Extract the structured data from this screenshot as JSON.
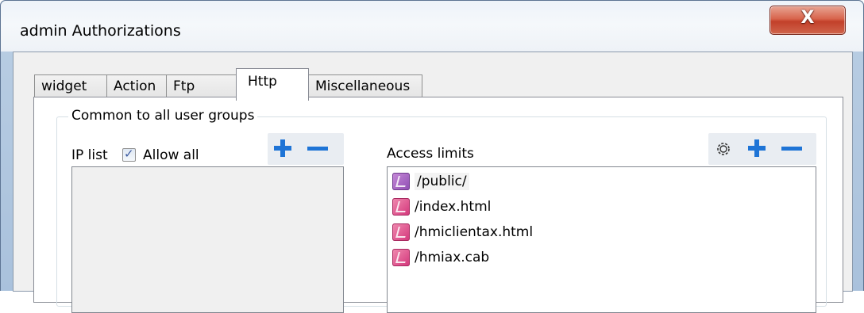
{
  "window": {
    "title": "admin Authorizations",
    "close_label": "X"
  },
  "tabs": [
    {
      "label": "widget",
      "active": false
    },
    {
      "label": "Action",
      "active": false
    },
    {
      "label": "Ftp",
      "active": false
    },
    {
      "label": "Http",
      "active": true
    },
    {
      "label": "Miscellaneous",
      "active": false
    }
  ],
  "group": {
    "legend": "Common to all user groups"
  },
  "ip_list": {
    "label": "IP list",
    "allow_all_label": "Allow all",
    "allow_all_checked": true,
    "items": []
  },
  "access_limits": {
    "label": "Access limits",
    "items": [
      {
        "path": "/public/",
        "selected": true
      },
      {
        "path": "/index.html",
        "selected": false
      },
      {
        "path": "/hmiclientax.html",
        "selected": false
      },
      {
        "path": "/hmiax.cab",
        "selected": false
      }
    ]
  },
  "icons": {
    "add": "plus-icon",
    "remove": "minus-icon",
    "settings": "gear-icon",
    "item": "page-icon"
  },
  "colors": {
    "accent": "#1e74d6",
    "close_button": "#c7503a"
  }
}
